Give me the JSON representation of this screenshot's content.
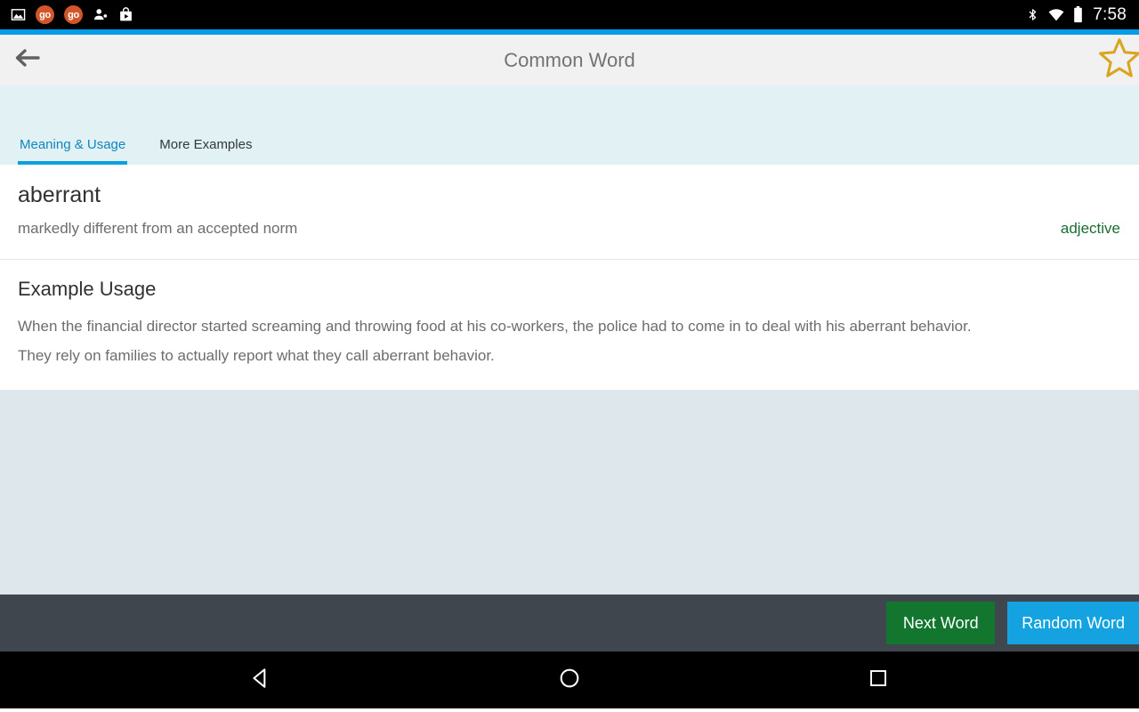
{
  "status_bar": {
    "icons": [
      {
        "name": "image-icon",
        "label": "image"
      },
      {
        "name": "go-badge-1",
        "label": "go"
      },
      {
        "name": "go-badge-2",
        "label": "go"
      },
      {
        "name": "person-add-icon",
        "label": "person-add"
      },
      {
        "name": "play-store-icon",
        "label": "play-store"
      }
    ],
    "right_icons": [
      {
        "name": "bluetooth-icon",
        "label": "bluetooth"
      },
      {
        "name": "wifi-icon",
        "label": "wifi"
      },
      {
        "name": "battery-icon",
        "label": "battery"
      }
    ],
    "time": "7:58",
    "background": "#000000"
  },
  "app_bar": {
    "title": "Common Word",
    "back_icon": "arrow-left-icon",
    "favorite_icon": "star-outline-icon",
    "background": "#f1f1f1",
    "accent_color": "#039be5",
    "star_color": "#d8a51d"
  },
  "tabs": {
    "background": "#e2f1f4",
    "active_color": "#0f87bf",
    "inactive_color": "#31393d",
    "indicator_color": "#0aa0dd",
    "items": [
      {
        "label": "Meaning & Usage",
        "active": true
      },
      {
        "label": "More Examples",
        "active": false
      }
    ]
  },
  "word_card": {
    "word": "aberrant",
    "definition": "markedly different from an accepted norm",
    "part_of_speech": "adjective",
    "pos_color": "#1b6b36"
  },
  "example_section": {
    "heading": "Example Usage",
    "lines": [
      "When the financial director started screaming and throwing food at his co-workers, the police had to come in to deal with his aberrant behavior.",
      "They rely on families to actually report what they call aberrant behavior."
    ]
  },
  "filler": {
    "background": "#dde7ec"
  },
  "action_bar": {
    "background": "#3f464d",
    "next_label": "Next Word",
    "next_color": "#12762f",
    "random_label": "Random Word",
    "random_color": "#14a3e0"
  },
  "nav_bar": {
    "background": "#000000",
    "buttons": [
      {
        "name": "nav-back-icon",
        "label": "back"
      },
      {
        "name": "nav-home-icon",
        "label": "home"
      },
      {
        "name": "nav-recents-icon",
        "label": "recents"
      }
    ]
  }
}
